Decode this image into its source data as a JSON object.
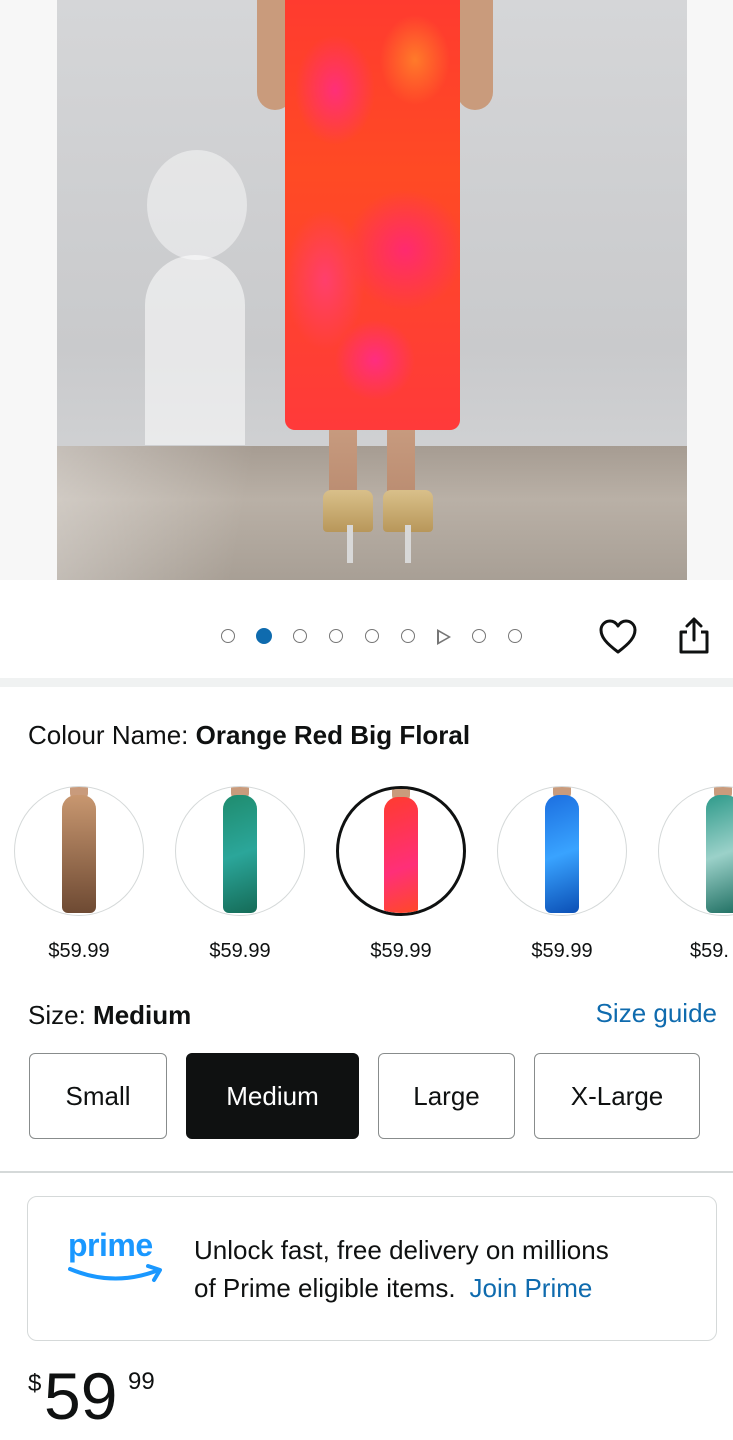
{
  "product": {
    "image_alt": "Orange Red Big Floral bodycon maxi dress",
    "carousel": {
      "dot_count": 8,
      "active_index": 1,
      "video_index": 6
    }
  },
  "colour": {
    "label": "Colour Name: ",
    "selected": "Orange Red Big Floral",
    "options": [
      {
        "price": "$59.99",
        "color": "#8a5a3b"
      },
      {
        "price": "$59.99",
        "color": "#1f8c6e"
      },
      {
        "price": "$59.99",
        "color": "#ff3b2f",
        "selected": true
      },
      {
        "price": "$59.99",
        "color": "#1c6fe0"
      },
      {
        "price": "$59.",
        "color": "#2e9a8a"
      }
    ]
  },
  "size": {
    "label": "Size: ",
    "selected": "Medium",
    "guide_link": "Size guide",
    "options": [
      "Small",
      "Medium",
      "Large",
      "X-Large"
    ]
  },
  "prime": {
    "logo_text": "prime",
    "message_line1": "Unlock fast, free delivery on millions",
    "message_line2": "of Prime eligible items.",
    "join_link": "Join Prime"
  },
  "price": {
    "symbol": "$",
    "whole": "59",
    "fraction": "99"
  },
  "colors": {
    "link": "#0f6bae",
    "prime_blue": "#1a98ff",
    "selected_size_bg": "#0f1111"
  }
}
